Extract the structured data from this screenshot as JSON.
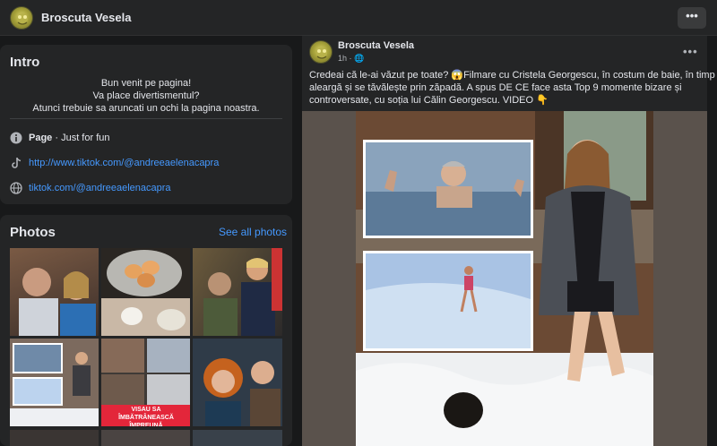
{
  "topbar": {
    "page_name": "Broscuta Vesela",
    "more_label": "•••"
  },
  "intro": {
    "title": "Intro",
    "lines": [
      "Bun venit pe pagina!",
      "Va place divertismentul?",
      "Atunci trebuie sa aruncati un ochi la pagina noastra."
    ],
    "category_label": "Page",
    "category_value": " · Just for fun",
    "link1": "http://www.tiktok.com/@andreeaelenacapra",
    "link2": "tiktok.com/@andreeaelenacapra"
  },
  "photos": {
    "title": "Photos",
    "see_all": "See all photos",
    "caption_banner": "VISAU SA ÎMBĂTRÂNEASCĂ ÎMPREUNĂ"
  },
  "post": {
    "author": "Broscuta Vesela",
    "time": "1h · 🌐",
    "more_label": "•••",
    "text_lines": [
      "Credeai că le-ai văzut pe toate? 😱Filmare cu Cristela Georgescu, în costum de baie, în timp ce",
      "aleargă și se tăvălește prin zăpadă. A spus DE CE face asta Top 9 momente bizare și",
      "controversate, cu soția lui Călin Georgescu. VIDEO 👇"
    ]
  },
  "colors": {
    "background": "#18191a",
    "card": "#242526",
    "link": "#4599ff",
    "text": "#e4e6eb"
  },
  "icons": [
    "avatar-logo",
    "more-dots-icon",
    "info-icon",
    "tiktok-icon",
    "globe-icon"
  ]
}
